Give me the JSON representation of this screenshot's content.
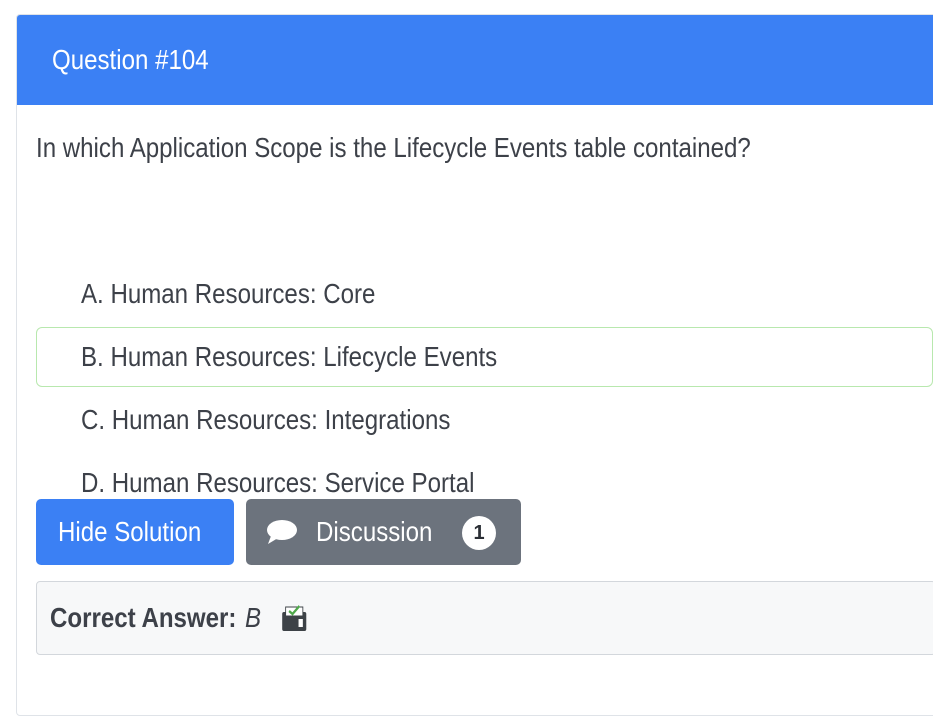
{
  "header": {
    "title": "Question #104"
  },
  "question": {
    "text": "In which Application Scope is the Lifecycle Events table contained?"
  },
  "choices": [
    {
      "label": "A. Human Resources: Core",
      "correct": false
    },
    {
      "label": "B. Human Resources: Lifecycle Events",
      "correct": true
    },
    {
      "label": "C. Human Resources: Integrations",
      "correct": false
    },
    {
      "label": "D. Human Resources: Service Portal",
      "correct": false
    }
  ],
  "buttons": {
    "hide_solution": "Hide Solution",
    "discussion": "Discussion",
    "discussion_count": "1"
  },
  "answer": {
    "label": "Correct Answer:",
    "value": "B",
    "icon": "vote-box-icon"
  },
  "colors": {
    "primary": "#3b80f4",
    "secondary": "#6c737d",
    "correct_border": "#b8e8ae"
  }
}
